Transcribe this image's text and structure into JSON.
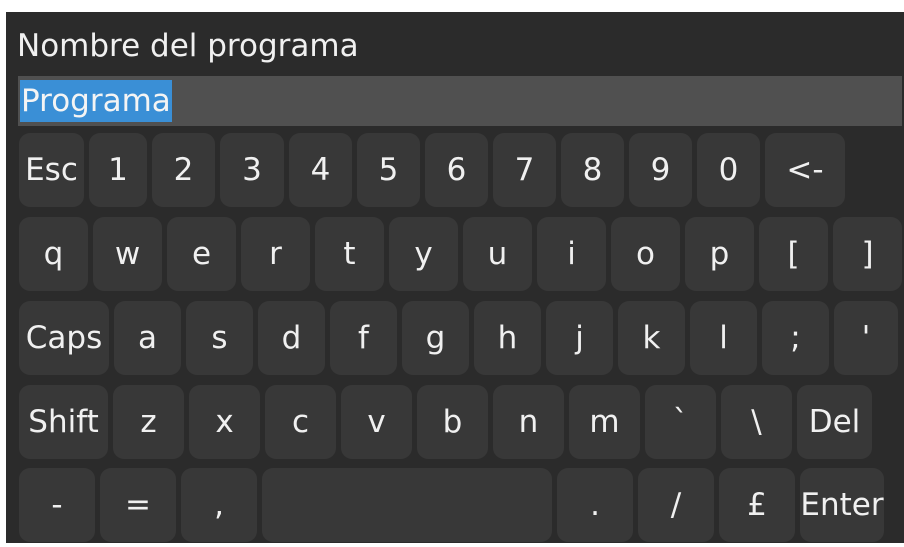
{
  "dialog": {
    "title": "Nombre del programa",
    "input_value": "Programa"
  },
  "keyboard": {
    "row1": [
      "Esc",
      "1",
      "2",
      "3",
      "4",
      "5",
      "6",
      "7",
      "8",
      "9",
      "0",
      "<-"
    ],
    "row2": [
      "q",
      "w",
      "e",
      "r",
      "t",
      "y",
      "u",
      "i",
      "o",
      "p",
      "[",
      "]"
    ],
    "row3": [
      "Caps",
      "a",
      "s",
      "d",
      "f",
      "g",
      "h",
      "j",
      "k",
      "l",
      ";",
      "'"
    ],
    "row4": [
      "Shift",
      "z",
      "x",
      "c",
      "v",
      "b",
      "n",
      "m",
      "`",
      "\\",
      "Del"
    ],
    "row5": [
      "-",
      "=",
      ",",
      "",
      ".",
      "/",
      "£",
      "Enter"
    ]
  },
  "colors": {
    "background": "#2b2b2b",
    "key": "#383838",
    "input": "#505050",
    "selection": "#3a8fd6",
    "text": "#f0f0f0"
  }
}
